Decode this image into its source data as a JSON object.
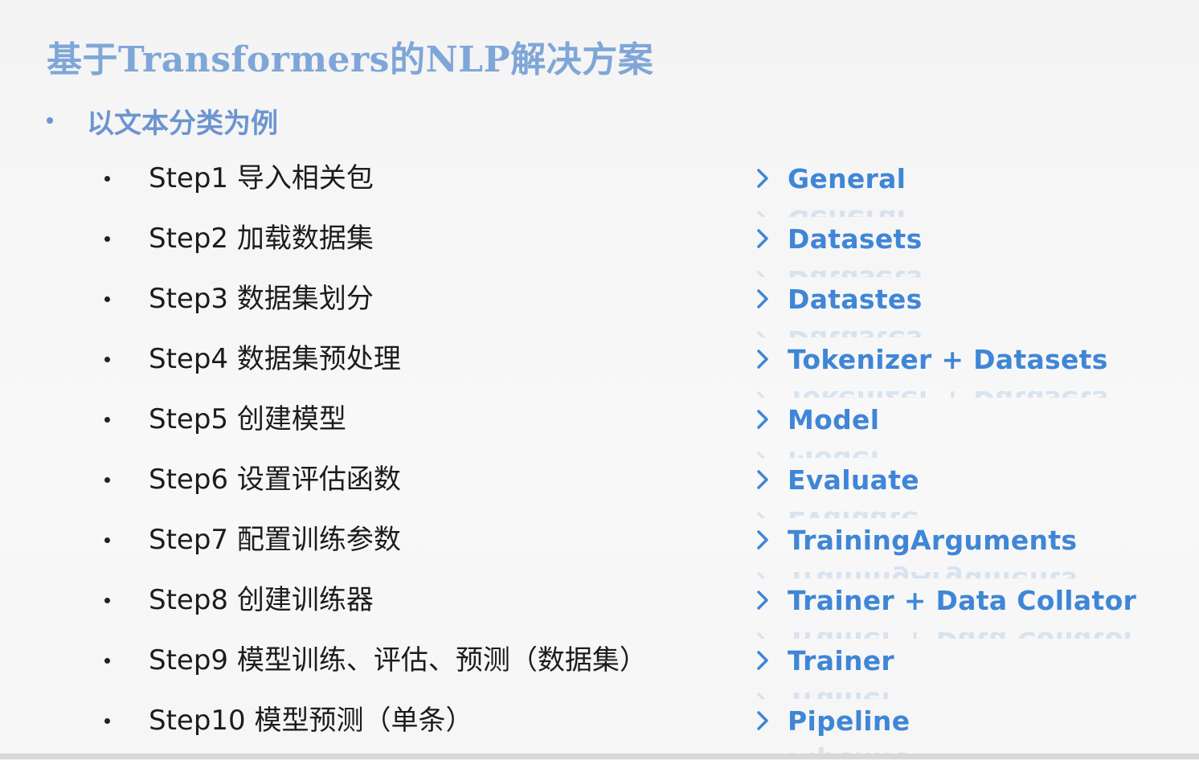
{
  "title": "基于Transformers的NLP解决方案",
  "subtitle": "以文本分类为例",
  "steps": [
    {
      "text": "Step1 导入相关包",
      "tool": "General"
    },
    {
      "text": "Step2 加载数据集",
      "tool": "Datasets"
    },
    {
      "text": "Step3 数据集划分",
      "tool": "Datastes"
    },
    {
      "text": "Step4 数据集预处理",
      "tool": "Tokenizer + Datasets"
    },
    {
      "text": "Step5 创建模型",
      "tool": "Model"
    },
    {
      "text": "Step6 设置评估函数",
      "tool": "Evaluate"
    },
    {
      "text": "Step7 配置训练参数",
      "tool": "TrainingArguments"
    },
    {
      "text": "Step8 创建训练器",
      "tool": "Trainer + Data Collator"
    },
    {
      "text": "Step9 模型训练、评估、预测（数据集）",
      "tool": "Trainer"
    },
    {
      "text": "Step10 模型预测（单条）",
      "tool": "Pipeline"
    }
  ],
  "colors": {
    "title": "#7fa6d8",
    "subtitle": "#6c95d0",
    "tool_label": "#3f86d6",
    "step_text": "#1c1c1c"
  },
  "icons": {
    "tool_marker": "chevron-right-icon"
  }
}
